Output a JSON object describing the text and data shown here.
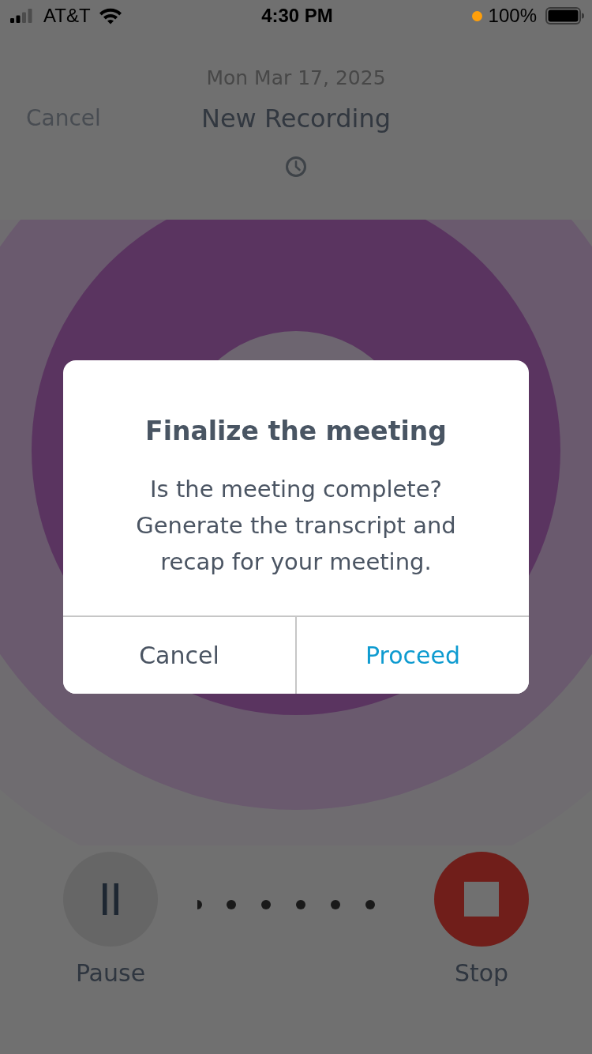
{
  "status_bar": {
    "carrier": "AT&T",
    "time": "4:30 PM",
    "battery": "100%"
  },
  "header": {
    "date": "Mon Mar 17, 2025",
    "cancel": "Cancel",
    "title": "New Recording"
  },
  "controls": [
    {
      "kind": "pause",
      "label": "Pause"
    },
    {
      "kind": "stop",
      "label": "Stop"
    }
  ],
  "dialog": {
    "title": "Finalize the meeting",
    "message": "Is the meeting complete? Generate the transcript and recap for your meeting.",
    "buttons": [
      {
        "kind": "cancel",
        "label": "Cancel"
      },
      {
        "kind": "confirm",
        "label": "Proceed"
      }
    ]
  }
}
